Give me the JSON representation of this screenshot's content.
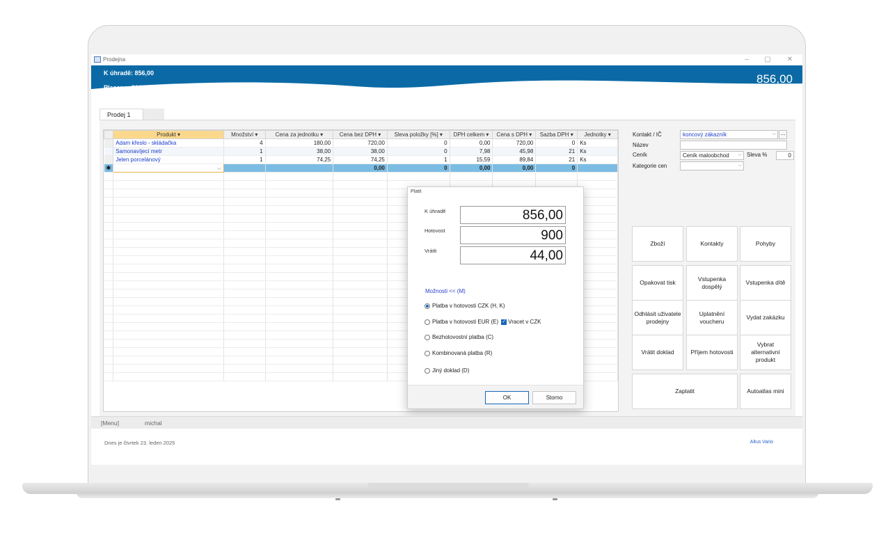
{
  "window": {
    "title": "Prodejna",
    "controls": [
      "–",
      "▢",
      "✕"
    ]
  },
  "header": {
    "due_label": "K úhradě: 856,00",
    "paid_label": "Placeno: 900,00",
    "total": "856,00"
  },
  "tabs": [
    {
      "label": "Prodej 1"
    },
    {
      "label": ""
    }
  ],
  "grid": {
    "columns": [
      "Produkt",
      "Množství",
      "Cena za jednotku",
      "Cena bez DPH",
      "Sleva položky [%]",
      "DPH celkem",
      "Cena s DPH",
      "Sazba DPH",
      "Jednotky"
    ],
    "rows": [
      {
        "product": "Adam křeslo - skládačka",
        "qty": "4",
        "unit_price": "180,00",
        "price_no_vat": "720,00",
        "discount": "0",
        "vat_total": "0,00",
        "price_vat": "720,00",
        "vat_rate": "0",
        "units": "Ks"
      },
      {
        "product": "Samonavíjecí metr",
        "qty": "1",
        "unit_price": "38,00",
        "price_no_vat": "38,00",
        "discount": "0",
        "vat_total": "7,98",
        "price_vat": "45,98",
        "vat_rate": "21",
        "units": "Ks"
      },
      {
        "product": "Jelen porcelánový",
        "qty": "1",
        "unit_price": "74,25",
        "price_no_vat": "74,25",
        "discount": "1",
        "vat_total": "15,59",
        "price_vat": "89,84",
        "vat_rate": "21",
        "units": "Ks"
      }
    ],
    "new_row": {
      "marker": "✱",
      "price_no_vat": "0,00",
      "discount": "0",
      "vat_total": "0,00",
      "price_vat": "0,00",
      "vat_rate": "0"
    }
  },
  "customer": {
    "contact_label": "Kontakt / IČ",
    "contact_value": "koncový zákazník",
    "name_label": "Název",
    "name_value": "",
    "pricelist_label": "Ceník",
    "pricelist_value": "Ceník maloobchod",
    "discount_label": "Sleva %",
    "discount_value": "0",
    "category_label": "Kategorie cen",
    "category_value": "",
    "more_button": "..."
  },
  "actions": [
    "Zboží",
    "Kontakty",
    "Pohyby",
    "Opakovat tisk",
    "Vstupenka dospělý",
    "Vstupenka dítě",
    "Odhlásit uživatele prodejny",
    "Uplatnění voucheru",
    "Vydat zakázku",
    "Vrátit doklad",
    "Příjem hotovosti",
    "Vybrat alternativní produkt",
    "Zaplatit",
    "Autoatlas mini"
  ],
  "dialog": {
    "title": "Platit",
    "due_label": "K úhradě",
    "due_value": "856,00",
    "cash_label": "Hotovost",
    "cash_value": "900",
    "change_label": "Vrátit",
    "change_value": "44,00",
    "options_link": "Možnosti << (M)",
    "payment_options": [
      {
        "label": "Platba v hotovosti CZK (H, K)",
        "selected": true
      },
      {
        "label": "Platba v hotovosti EUR (E)",
        "selected": false
      },
      {
        "label": "Bezhotovostní platba (C)",
        "selected": false
      },
      {
        "label": "Kombinovaná platba (R)",
        "selected": false
      },
      {
        "label": "Jiný doklad (D)",
        "selected": false
      }
    ],
    "return_czk_label": "Vracet v CZK",
    "return_czk_checked": true,
    "ok": "OK",
    "cancel": "Storno"
  },
  "status": {
    "menu": "[Menu]",
    "user": "michal"
  },
  "footer": {
    "date": "Dnes je čtvrtek 23. leden 2025",
    "brand": "Altus Vario"
  },
  "colors": {
    "header": "#0b6aa6",
    "accent": "#1666b9",
    "product_link": "#1a3cc8",
    "selected_row": "#7bbce3"
  }
}
